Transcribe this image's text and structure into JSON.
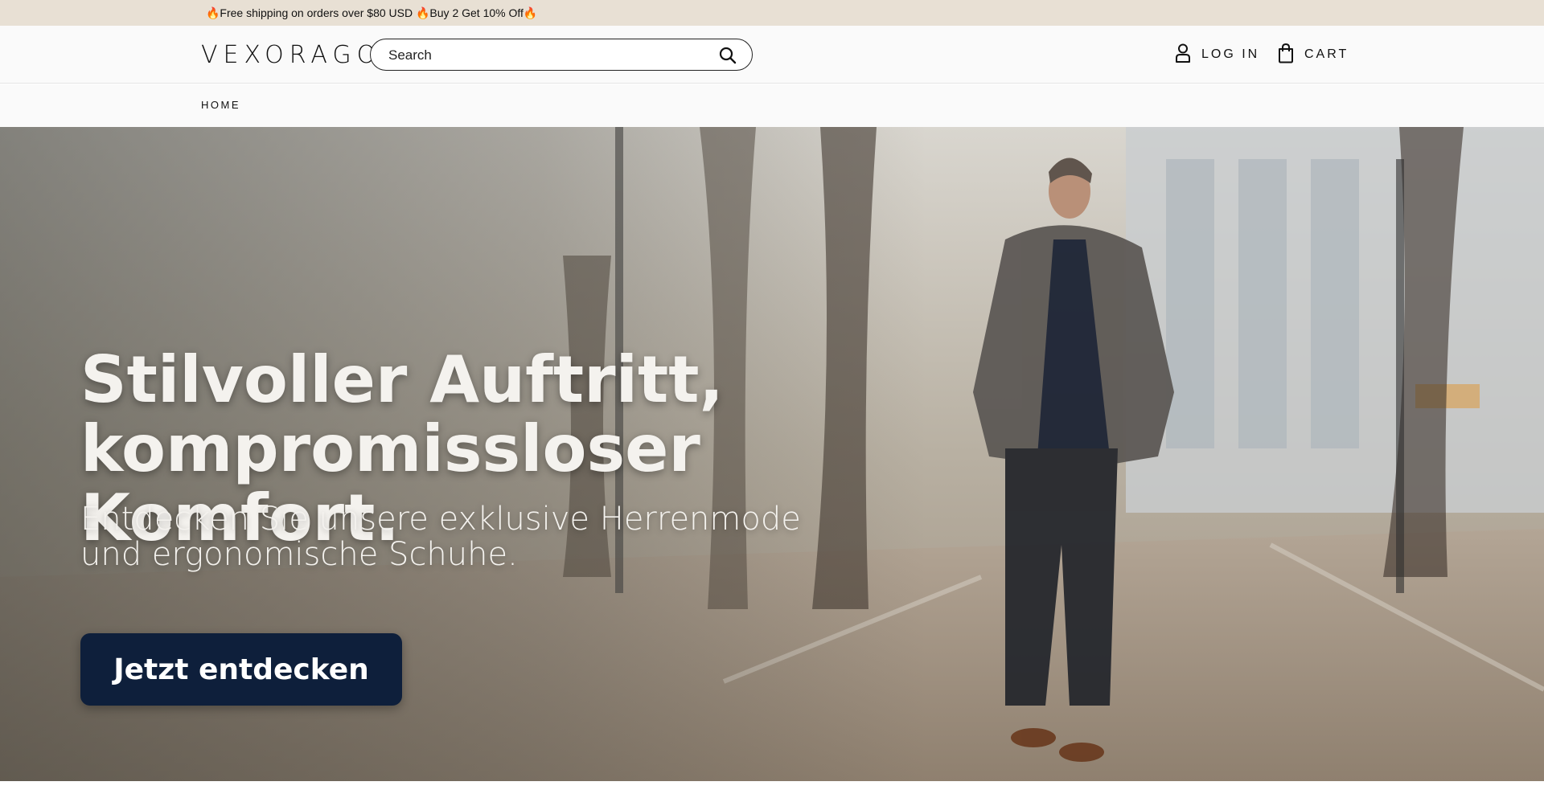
{
  "announcement": {
    "text": "🔥Free shipping on orders over $80 USD 🔥Buy 2 Get 10% Off🔥"
  },
  "header": {
    "logo": "VEXORAGO",
    "search": {
      "placeholder": "Search",
      "value": ""
    },
    "login_label": "LOG IN",
    "cart_label": "CART"
  },
  "nav": {
    "items": [
      {
        "label": "HOME"
      }
    ]
  },
  "hero": {
    "title_line1": "Stilvoller Auftritt,",
    "title_line2": "kompromissloser Komfort.",
    "subtitle_line1": "Entdecken Sie unsere exklusive Herrenmode",
    "subtitle_line2": "und ergonomische Schuhe.",
    "cta_label": "Jetzt entdecken"
  },
  "colors": {
    "announcement_bg": "#e8e0d4",
    "header_bg": "#fafafa",
    "cta_bg": "#0e1f3b",
    "hero_text": "#f4f2ee"
  }
}
